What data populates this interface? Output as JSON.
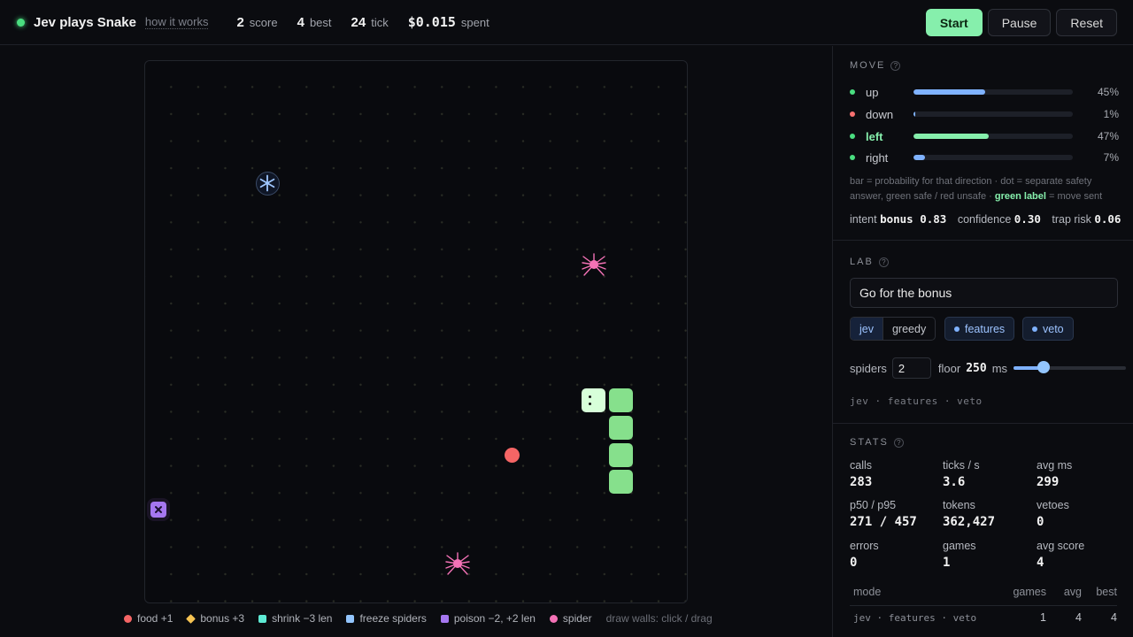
{
  "header": {
    "title": "Jev plays Snake",
    "how_link": "how it works",
    "stats": [
      {
        "value": "2",
        "label": "score"
      },
      {
        "value": "4",
        "label": "best"
      },
      {
        "value": "24",
        "label": "tick"
      },
      {
        "value": "$0.015",
        "label": "spent"
      }
    ],
    "buttons": {
      "start": "Start",
      "pause": "Pause",
      "reset": "Reset"
    }
  },
  "board": {
    "grid_cols": 20,
    "grid_rows": 20,
    "snake": {
      "head": [
        16,
        12
      ],
      "body": [
        [
          17,
          12
        ],
        [
          17,
          13
        ],
        [
          17,
          14
        ],
        [
          17,
          15
        ]
      ]
    },
    "food": [
      13,
      14
    ],
    "freeze": [
      4,
      4
    ],
    "poison": [
      0,
      16
    ],
    "spiders": [
      [
        16,
        7
      ],
      [
        11,
        18
      ]
    ]
  },
  "legend": {
    "items": [
      {
        "label": "food +1",
        "color": "#f56565",
        "shape": "circle"
      },
      {
        "label": "bonus +3",
        "color": "#f6c453",
        "shape": "diamond"
      },
      {
        "label": "shrink −3 len",
        "color": "#5eead4",
        "shape": "square"
      },
      {
        "label": "freeze spiders",
        "color": "#93c5fd",
        "shape": "square"
      },
      {
        "label": "poison −2, +2 len",
        "color": "#a577f0",
        "shape": "square"
      },
      {
        "label": "spider",
        "color": "#f472b6",
        "shape": "circle"
      }
    ],
    "hint": "draw walls: click / drag"
  },
  "move": {
    "title": "MOVE",
    "rows": [
      {
        "label": "up",
        "pct": "45%",
        "value": 0.45,
        "safe": true,
        "sent": false
      },
      {
        "label": "down",
        "pct": "1%",
        "value": 0.01,
        "safe": false,
        "sent": false
      },
      {
        "label": "left",
        "pct": "47%",
        "value": 0.47,
        "safe": true,
        "sent": true
      },
      {
        "label": "right",
        "pct": "7%",
        "value": 0.07,
        "safe": true,
        "sent": false
      }
    ],
    "note_a": "bar = probability for that direction · dot = separate safety answer, green safe / red unsafe · ",
    "note_green": "green label",
    "note_b": " = move sent",
    "intent_label": "intent",
    "intent_value": "bonus 0.83",
    "confidence_label": "confidence",
    "confidence_value": "0.30",
    "trap_label": "trap risk",
    "trap_value": "0.06",
    "colors": {
      "safe": "#4ade80",
      "unsafe": "#f87171",
      "bar": "#7fb2ff",
      "bar_sent": "#86efac"
    }
  },
  "lab": {
    "title": "LAB",
    "prompt_value": "Go for the bonus",
    "modes": [
      "jev",
      "greedy"
    ],
    "active_mode": "jev",
    "toggles": [
      "features",
      "veto"
    ],
    "spiders_label": "spiders",
    "spiders_value": "2",
    "floor_label": "floor",
    "floor_value": "250",
    "floor_unit": "ms",
    "floor_level": 0.27,
    "config_line": "jev · features · veto"
  },
  "stats": {
    "title": "STATS",
    "items": [
      {
        "label": "calls",
        "value": "283"
      },
      {
        "label": "ticks / s",
        "value": "3.6"
      },
      {
        "label": "avg ms",
        "value": "299"
      },
      {
        "label": "p50 / p95",
        "value": "271 / 457"
      },
      {
        "label": "tokens",
        "value": "362,427"
      },
      {
        "label": "vetoes",
        "value": "0"
      },
      {
        "label": "errors",
        "value": "0"
      },
      {
        "label": "games",
        "value": "1"
      },
      {
        "label": "avg score",
        "value": "4"
      }
    ],
    "table": {
      "headers": [
        "mode",
        "games",
        "avg",
        "best"
      ],
      "rows": [
        {
          "mode": "jev · features · veto",
          "games": "1",
          "avg": "4",
          "best": "4"
        }
      ]
    }
  }
}
